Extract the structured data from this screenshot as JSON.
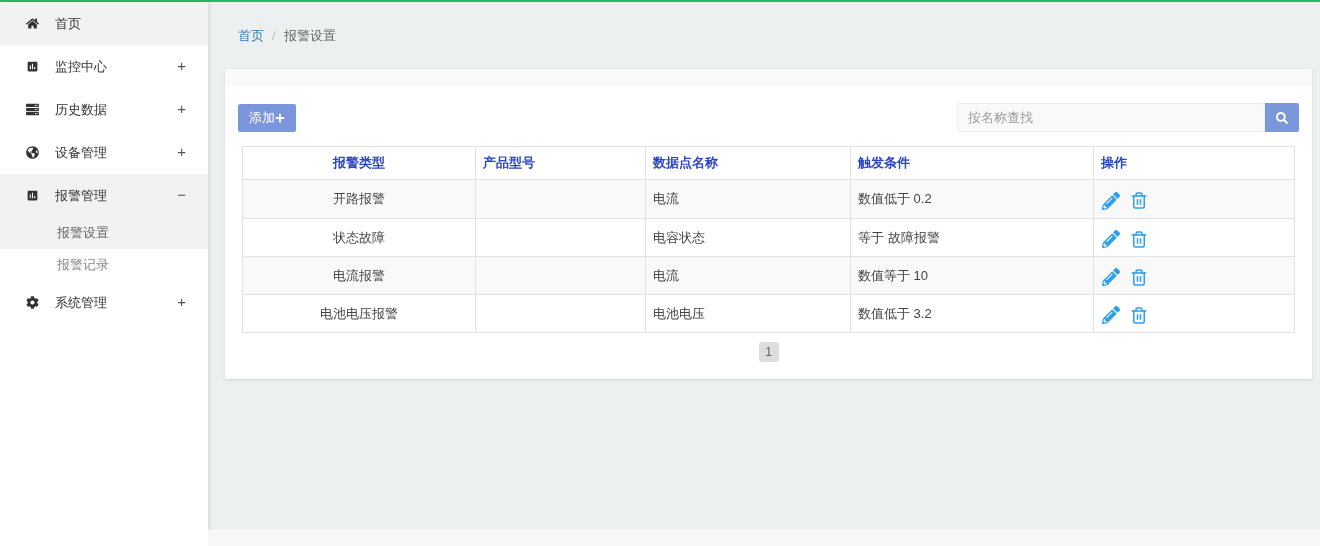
{
  "sidebar": {
    "items": [
      {
        "label": "首页",
        "selected": true
      },
      {
        "label": "监控中心",
        "toggle": "+",
        "expanded": false
      },
      {
        "label": "历史数据",
        "toggle": "+",
        "expanded": false
      },
      {
        "label": "设备管理",
        "toggle": "+",
        "expanded": false
      },
      {
        "label": "报警管理",
        "toggle": "−",
        "expanded": true,
        "children": [
          {
            "label": "报警设置",
            "selected": true
          },
          {
            "label": "报警记录",
            "selected": false
          }
        ]
      },
      {
        "label": "系统管理",
        "toggle": "+",
        "expanded": false
      }
    ]
  },
  "breadcrumb": [
    {
      "label": "首页",
      "kind": "link"
    },
    {
      "label": "/",
      "kind": "separator"
    },
    {
      "label": "报警设置",
      "kind": "current"
    }
  ],
  "add_button": "添加",
  "search": {
    "placeholder": "按名称查找"
  },
  "table": {
    "columns": [
      "报警类型",
      "产品型号",
      "数据点名称",
      "触发条件",
      "操作"
    ],
    "rows": [
      [
        "开路报警",
        "",
        "电流",
        "数值低于 0.2"
      ],
      [
        "状态故障",
        "",
        "电容状态",
        "等于 故障报警"
      ],
      [
        "电流报警",
        "",
        "电流",
        "数值等于 10"
      ],
      [
        "电池电压报警",
        "",
        "电池电压",
        "数值低于 3.2"
      ]
    ]
  },
  "pagination": [
    {
      "label": "1",
      "selected": true
    }
  ]
}
